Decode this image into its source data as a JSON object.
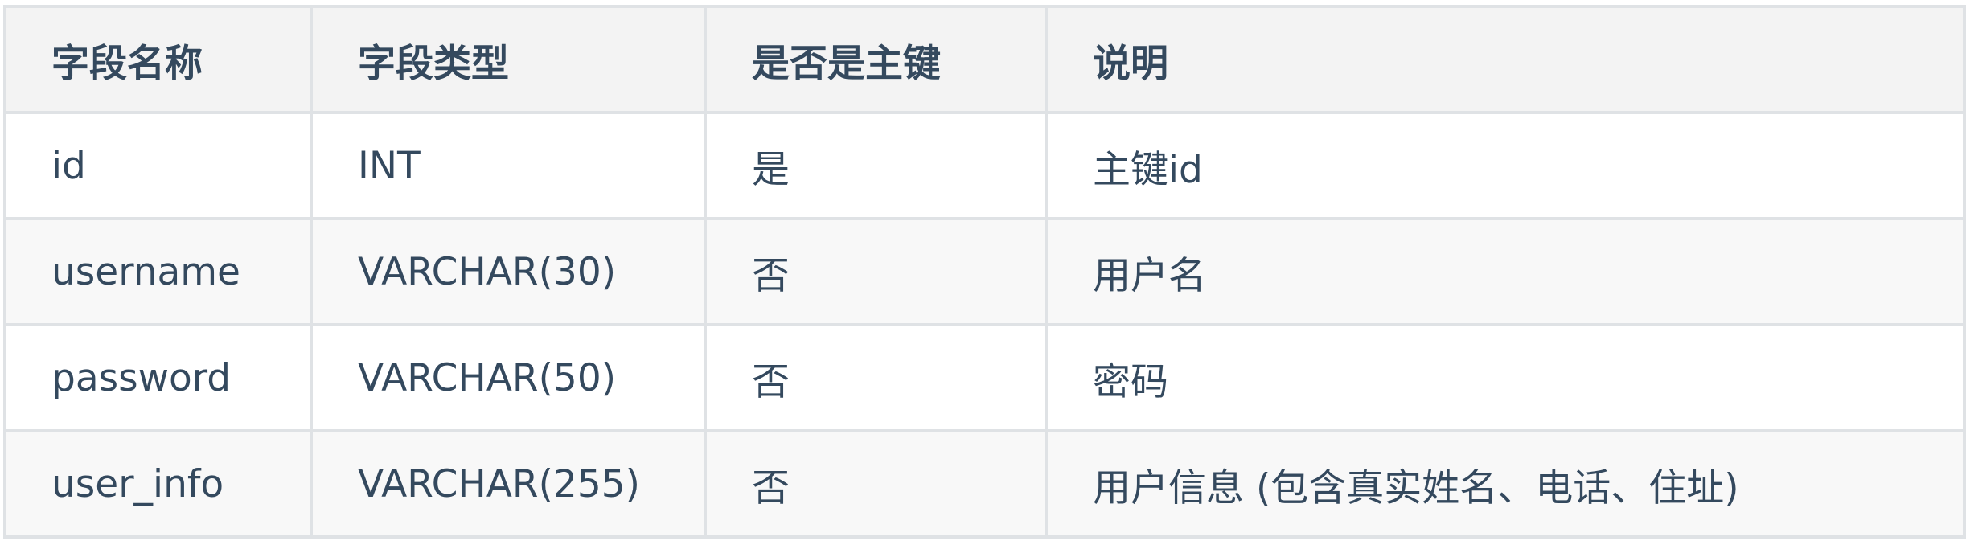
{
  "table": {
    "headers": [
      "字段名称",
      "字段类型",
      "是否是主键",
      "说明"
    ],
    "rows": [
      [
        "id",
        "INT",
        "是",
        "主键id"
      ],
      [
        "username",
        "VARCHAR(30)",
        "否",
        "用户名"
      ],
      [
        "password",
        "VARCHAR(50)",
        "否",
        "密码"
      ],
      [
        "user_info",
        "VARCHAR(255)",
        "否",
        "用户信息 (包含真实姓名、电话、住址)"
      ]
    ]
  }
}
